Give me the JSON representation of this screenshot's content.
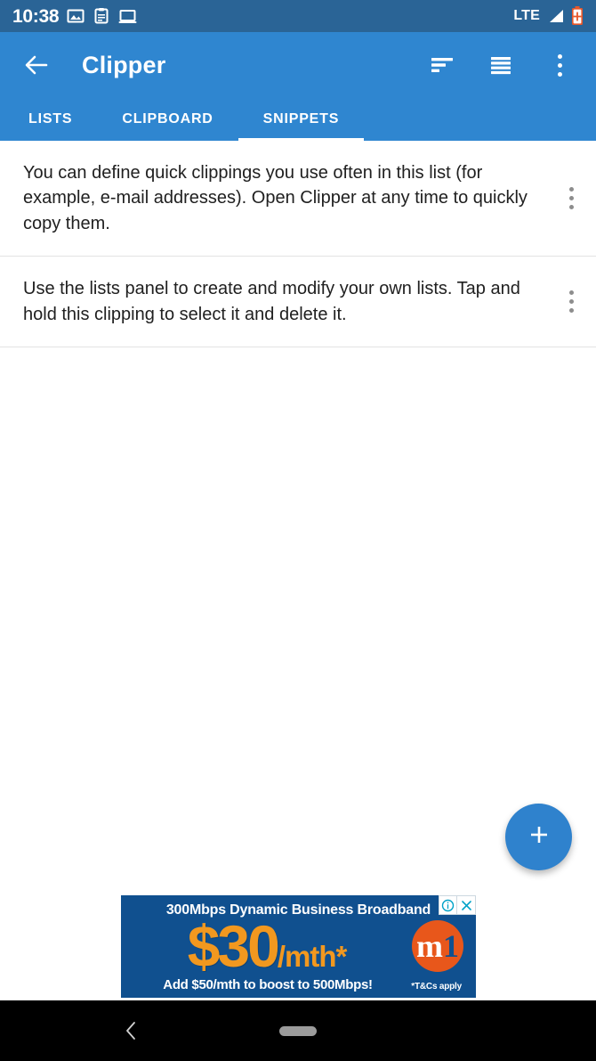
{
  "status_bar": {
    "time": "10:38",
    "icons": [
      "image-icon",
      "clipboard-icon",
      "monitor-icon"
    ],
    "network": "LTE",
    "signal_icon": "signal-triangle-icon",
    "battery_icon": "battery-charging-icon",
    "background_color": "#2a6496"
  },
  "app_bar": {
    "back_icon": "arrow-back-icon",
    "title": "Clipper",
    "actions": [
      {
        "name": "sort-icon"
      },
      {
        "name": "list-view-icon"
      },
      {
        "name": "overflow-menu-icon"
      }
    ],
    "background_color": "#2f86d0"
  },
  "tabs": [
    {
      "label": "LISTS",
      "active": false
    },
    {
      "label": "CLIPBOARD",
      "active": false
    },
    {
      "label": "SNIPPETS",
      "active": true
    }
  ],
  "snippets": [
    {
      "text": "You can define quick clippings you use often in this list (for example, e-mail addresses). Open Clipper at any time to quickly copy them.",
      "overflow_icon": "overflow-menu-icon"
    },
    {
      "text": "Use the lists panel to create and modify your own lists. Tap and hold this clipping to select it and delete it.",
      "overflow_icon": "overflow-menu-icon"
    }
  ],
  "fab": {
    "icon": "plus-icon",
    "label": "+",
    "color": "#2f82cd"
  },
  "ad": {
    "headline": "300Mbps Dynamic Business Broadband",
    "price": "$30",
    "period": "/mth*",
    "subline": "Add $50/mth to boost to 500Mbps!",
    "logo_m": "m",
    "logo_1": "1",
    "terms": "*T&Cs apply",
    "info_icon": "adchoices-info-icon",
    "close_icon": "close-icon",
    "background_color": "#10508f",
    "accent_color": "#f2981f"
  },
  "nav_bar": {
    "back_icon": "nav-back-chevron-icon",
    "home_indicator": "home-pill-indicator"
  }
}
